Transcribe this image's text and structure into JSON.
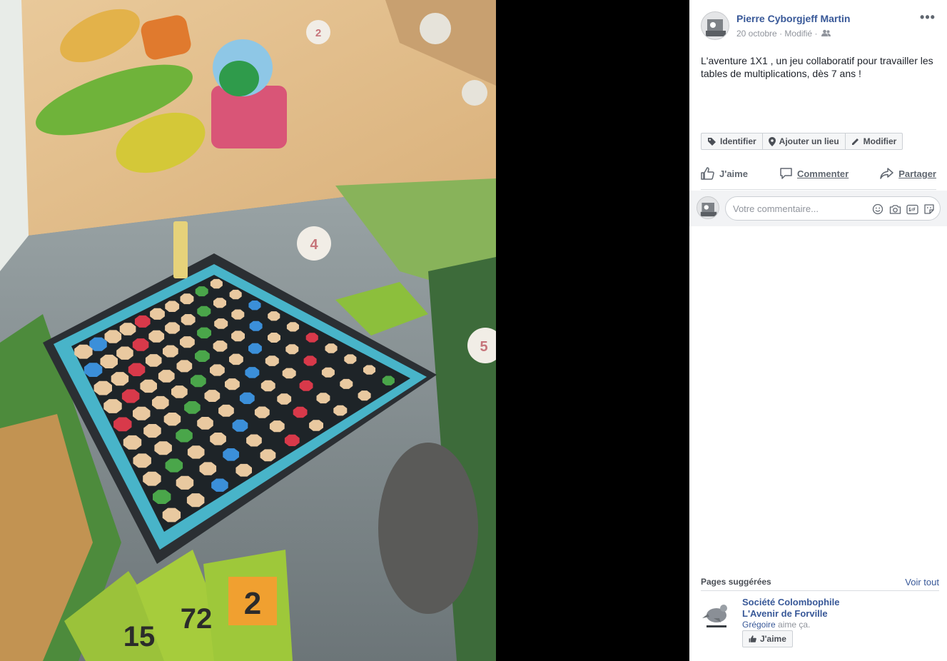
{
  "post": {
    "author": "Pierre Cyborgjeff Martin",
    "date": "20 octobre",
    "edited": "Modifié",
    "separator": "·",
    "more_label": "•••",
    "text": "L'aventure 1X1 , un jeu collaboratif pour travailler les tables de multiplications, dès 7 ans !"
  },
  "tag_bar": {
    "identify": "Identifier",
    "add_place": "Ajouter un lieu",
    "edit": "Modifier"
  },
  "actions": {
    "like": "J'aime",
    "comment": "Commenter",
    "share": "Partager"
  },
  "comment": {
    "placeholder": "Votre commentaire..."
  },
  "suggested": {
    "title": "Pages suggérées",
    "see_all": "Voir tout",
    "page_name_line1": "Société Colombophile",
    "page_name_line2": "L'Avenir de Forville",
    "liker": "Grégoire",
    "liker_suffix": " aime ça.",
    "like_button": "J'aime"
  },
  "photo": {
    "number_badges": [
      "2",
      "4",
      "5"
    ],
    "card_numbers": [
      "15",
      "72",
      "2"
    ]
  },
  "colors": {
    "link": "#385898",
    "panel_bg": "#ffffff",
    "input_bar_bg": "#f2f3f5"
  }
}
